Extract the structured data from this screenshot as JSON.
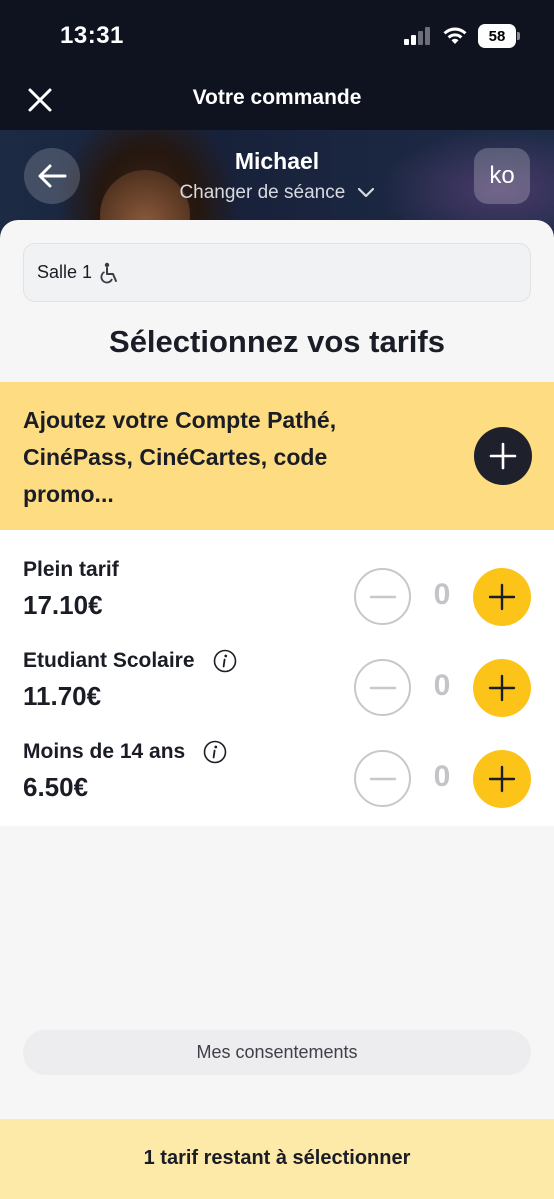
{
  "status_bar": {
    "time": "13:31",
    "battery": "58"
  },
  "nav": {
    "title": "Votre commande"
  },
  "movie": {
    "title": "Michael",
    "change_session": "Changer de séance",
    "avatar_initials": "ko"
  },
  "room": {
    "label": "Salle 1"
  },
  "section_title": "Sélectionnez vos tarifs",
  "promo": {
    "text": "Ajoutez votre Compte Pathé, CinéPass, CinéCartes, code promo..."
  },
  "tariffs": [
    {
      "name": "Plein tarif",
      "price": "17.10€",
      "quantity": "0",
      "has_info": false
    },
    {
      "name": "Etudiant Scolaire",
      "price": "11.70€",
      "quantity": "0",
      "has_info": true
    },
    {
      "name": "Moins de 14 ans",
      "price": "6.50€",
      "quantity": "0",
      "has_info": true
    }
  ],
  "consent": {
    "label": "Mes consentements"
  },
  "footer": {
    "message": "1 tarif restant à sélectionner"
  },
  "colors": {
    "accent_yellow": "#fcc419",
    "promo_banner": "#fddc82",
    "footer_banner": "#fde9a8",
    "dark": "#1e212b"
  }
}
